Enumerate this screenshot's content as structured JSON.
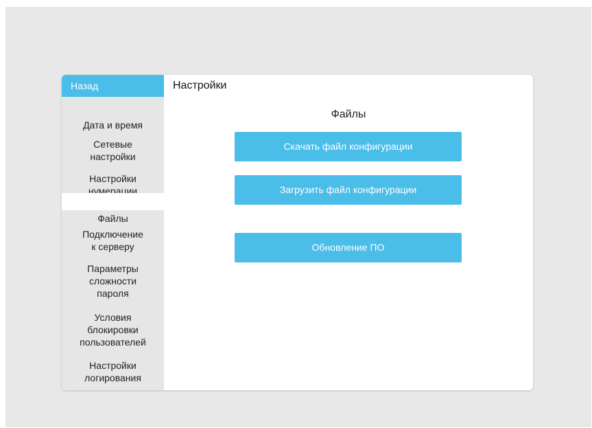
{
  "sidebar": {
    "back_label": "Назад",
    "items": [
      {
        "label": "Дата и время"
      },
      {
        "label": "Сетевые\nнастройки"
      },
      {
        "label": "Настройки\nнумерации"
      },
      {
        "label": "Файлы",
        "active": true
      },
      {
        "label": "Подключение\nк серверу"
      },
      {
        "label": "Параметры\nсложности\nпароля"
      },
      {
        "label": "Условия\nблокировки\nпользователей"
      },
      {
        "label": "Настройки\nлогирования"
      }
    ]
  },
  "content": {
    "title": "Настройки",
    "section_title": "Файлы",
    "buttons": {
      "download_config": "Скачать файл конфигурации",
      "upload_config": "Загрузить файл конфигурации",
      "firmware_update": "Обновление ПО"
    }
  },
  "colors": {
    "accent": "#4bbde9",
    "sidebar_bg": "#e6e6e6",
    "page_bg": "#e8e8e8"
  }
}
